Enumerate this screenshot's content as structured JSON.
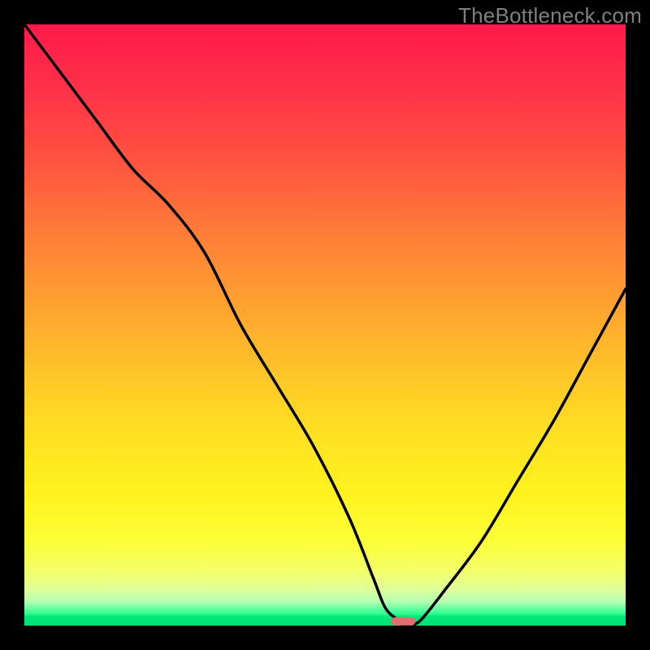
{
  "watermark": "TheBottleneck.com",
  "chart_data": {
    "type": "line",
    "title": "",
    "xlabel": "",
    "ylabel": "",
    "xlim": [
      0,
      100
    ],
    "ylim": [
      0,
      100
    ],
    "axes_visible": false,
    "grid": false,
    "background": "red-yellow-green vertical gradient (bottleneck heatmap)",
    "series": [
      {
        "name": "bottleneck-curve",
        "x": [
          0,
          6,
          12,
          18,
          24,
          30,
          36,
          42,
          48,
          54,
          58,
          60,
          62,
          63,
          64,
          66,
          70,
          76,
          82,
          88,
          94,
          100
        ],
        "y": [
          100,
          92,
          84,
          76,
          70,
          62,
          50,
          40,
          30,
          18,
          8,
          3,
          1,
          0,
          0,
          1,
          6,
          14,
          24,
          34,
          45,
          56
        ]
      }
    ],
    "marker": {
      "name": "optimal-point",
      "x": 63,
      "y": 0.7,
      "shape": "pill",
      "color": "#e07070"
    }
  }
}
